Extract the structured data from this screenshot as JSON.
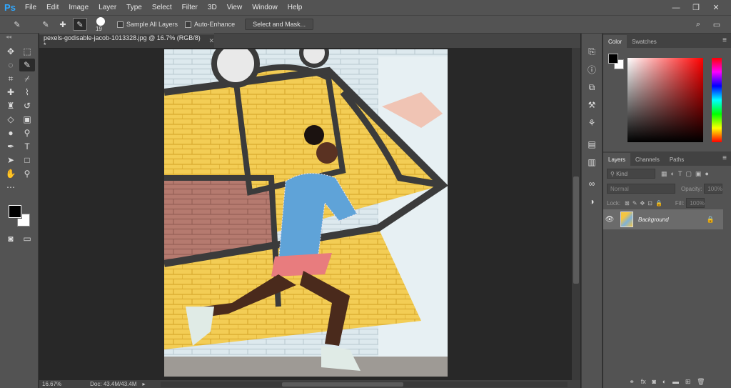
{
  "app": {
    "logo": "Ps"
  },
  "menu": [
    "File",
    "Edit",
    "Image",
    "Layer",
    "Type",
    "Select",
    "Filter",
    "3D",
    "View",
    "Window",
    "Help"
  ],
  "window_controls": {
    "minimize": "—",
    "restore": "❐",
    "close": "✕"
  },
  "options": {
    "brush_size": "19",
    "sample_all_layers": "Sample All Layers",
    "auto_enhance": "Auto-Enhance",
    "select_and_mask": "Select and Mask..."
  },
  "document": {
    "tab_title": "pexels-godisable-jacob-1013328.jpg @ 16.7% (RGB/8) *",
    "zoom": "16.67%",
    "doc_info": "Doc: 43.4M/43.4M"
  },
  "color_panel": {
    "tabs": [
      "Color",
      "Swatches"
    ]
  },
  "layers_panel": {
    "tabs": [
      "Layers",
      "Channels",
      "Paths"
    ],
    "kind_label": "Kind",
    "blend_mode": "Normal",
    "opacity_label": "Opacity:",
    "opacity_value": "100%",
    "lock_label": "Lock:",
    "fill_label": "Fill:",
    "fill_value": "100%",
    "layer_name": "Background"
  },
  "colors": {
    "accent": "#31a8ff",
    "panel": "#535353",
    "canvas_bg": "#282828"
  }
}
